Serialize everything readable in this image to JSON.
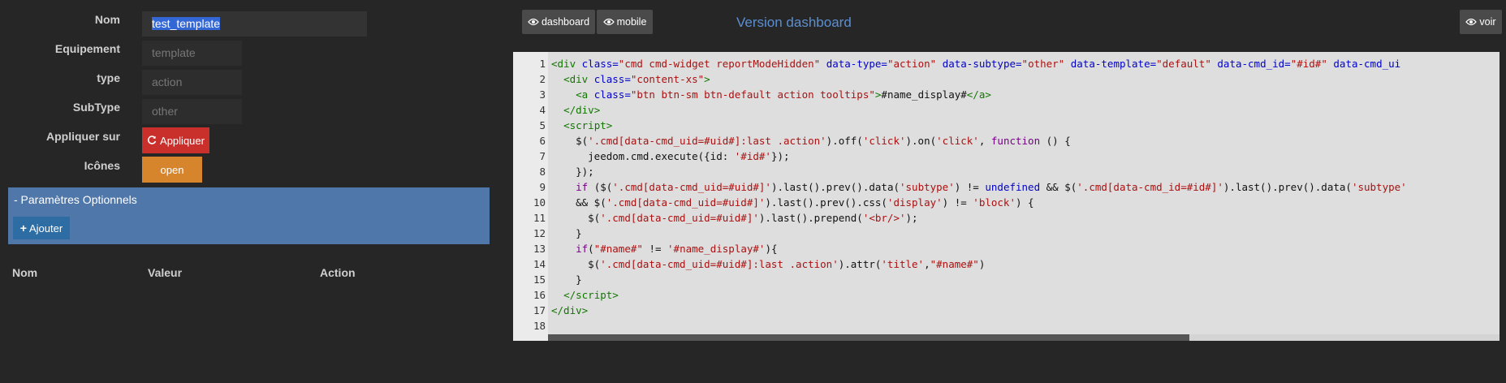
{
  "form": {
    "nom_label": "Nom",
    "nom_value": "test_template",
    "equipement_label": "Equipement",
    "equipement_placeholder": "template",
    "type_label": "type",
    "type_placeholder": "action",
    "subtype_label": "SubType",
    "subtype_placeholder": "other",
    "appliquer_label": "Appliquer sur",
    "appliquer_button": "Appliquer",
    "icones_label": "Icônes",
    "open_button": "open"
  },
  "optional_panel": {
    "title": "- Paramètres Optionnels",
    "add_button": "Ajouter"
  },
  "table": {
    "headers": [
      "Nom",
      "Valeur",
      "Action"
    ]
  },
  "top": {
    "dashboard_button": "dashboard",
    "mobile_button": "mobile",
    "version_title": "Version dashboard",
    "voir_button": "voir"
  },
  "colors": {
    "accent_blue": "#5b8fd1",
    "apply_red": "#c9302c",
    "open_orange": "#d7852d",
    "panel_blue": "#4f77aa"
  },
  "editor": {
    "line_numbers": [
      "1",
      "2",
      "3",
      "4",
      "5",
      "6",
      "7",
      "8",
      "9",
      "10",
      "11",
      "12",
      "13",
      "14",
      "15",
      "16",
      "17",
      "18"
    ]
  }
}
